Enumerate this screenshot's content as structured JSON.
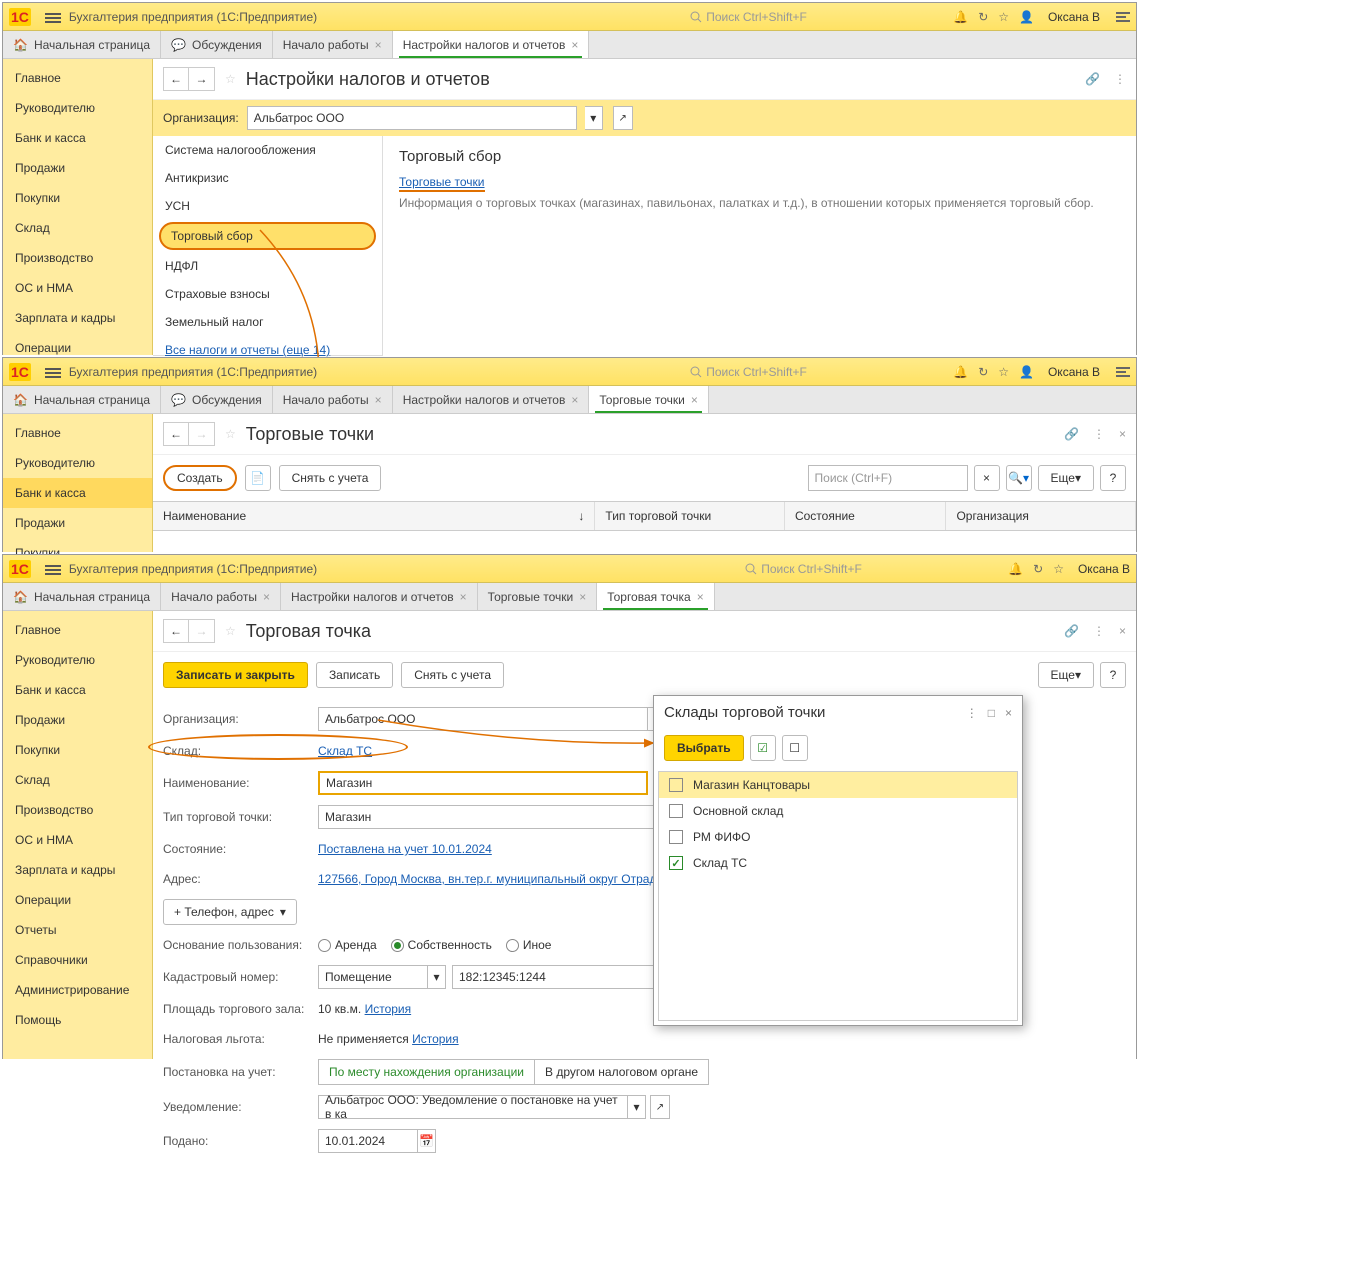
{
  "app": {
    "title": "Бухгалтерия предприятия  (1С:Предприятие)",
    "search_ph": "Поиск Ctrl+Shift+F",
    "user": "Оксана В"
  },
  "sidebar": {
    "items": [
      "Главное",
      "Руководителю",
      "Банк и касса",
      "Продажи",
      "Покупки",
      "Склад",
      "Производство",
      "ОС и НМА",
      "Зарплата и кадры",
      "Операции",
      "Отчеты",
      "Справочники",
      "Администрирование",
      "Помощь"
    ]
  },
  "win1": {
    "tabs": {
      "home": "Начальная страница",
      "discuss": "Обсуждения",
      "start": "Начало работы",
      "settings": "Настройки налогов и отчетов"
    },
    "title": "Настройки налогов и отчетов",
    "org_label": "Организация:",
    "org_value": "Альбатрос ООО",
    "nav": [
      "Система налогообложения",
      "Антикризис",
      "УСН",
      "Торговый сбор",
      "НДФЛ",
      "Страховые взносы",
      "Земельный налог"
    ],
    "nav_more": "Все налоги и отчеты (еще 14)",
    "detail_title": "Торговый сбор",
    "detail_link": "Торговые точки",
    "detail_desc": "Информация о торговых точках (магазинах, павильонах, палатках и т.д.), в отношении которых применяется торговый сбор."
  },
  "win2": {
    "tabs": {
      "home": "Начальная страница",
      "discuss": "Обсуждения",
      "start": "Начало работы",
      "settings": "Настройки налогов и отчетов",
      "points": "Торговые точки"
    },
    "title": "Торговые точки",
    "btn_create": "Создать",
    "btn_remove": "Снять с учета",
    "search_ph": "Поиск (Ctrl+F)",
    "btn_more": "Еще",
    "cols": {
      "name": "Наименование",
      "type": "Тип торговой точки",
      "state": "Состояние",
      "org": "Организация"
    },
    "sidebar_hl": "Банк и касса"
  },
  "win3": {
    "tabs": {
      "home": "Начальная страница",
      "start": "Начало работы",
      "settings": "Настройки налогов и отчетов",
      "points": "Торговые точки",
      "point": "Торговая точка"
    },
    "title": "Торговая точка",
    "btn_save_close": "Записать и закрыть",
    "btn_save": "Записать",
    "btn_remove": "Снять с учета",
    "btn_more": "Еще",
    "form": {
      "org_lbl": "Организация:",
      "org_val": "Альбатрос ООО",
      "wh_lbl": "Склад:",
      "wh_val": "Склад ТС",
      "name_lbl": "Наименование:",
      "name_val": "Магазин",
      "type_lbl": "Тип торговой точки:",
      "type_val": "Магазин",
      "state_lbl": "Состояние:",
      "state_val": "Поставлена на учет 10.01.2024",
      "addr_lbl": "Адрес:",
      "addr_val": "127566, Город Москва, вн.тер.г. муниципальный округ Отрадное, ш Алту",
      "add_phone": "+ Телефон, адрес",
      "basis_lbl": "Основание пользования:",
      "basis_opts": [
        "Аренда",
        "Собственность",
        "Иное"
      ],
      "kad_lbl": "Кадастровый номер:",
      "kad_type": "Помещение",
      "kad_val": "182:12345:1244",
      "area_lbl": "Площадь торгового зала:",
      "area_val": "10 кв.м.",
      "history": "История",
      "benefit_lbl": "Налоговая льгота:",
      "benefit_val": "Не применяется",
      "reg_lbl": "Постановка на учет:",
      "reg_opts": [
        "По месту нахождения организации",
        "В другом налоговом органе"
      ],
      "notif_lbl": "Уведомление:",
      "notif_val": "Альбатрос ООО: Уведомление о постановке на учет в ка",
      "filed_lbl": "Подано:",
      "filed_val": "10.01.2024"
    }
  },
  "popup": {
    "title": "Склады торговой точки",
    "btn_select": "Выбрать",
    "items": [
      {
        "label": "Магазин Канцтовары",
        "checked": false,
        "sel": true
      },
      {
        "label": "Основной склад",
        "checked": false
      },
      {
        "label": "РМ ФИФО",
        "checked": false
      },
      {
        "label": "Склад ТС",
        "checked": true
      }
    ]
  }
}
